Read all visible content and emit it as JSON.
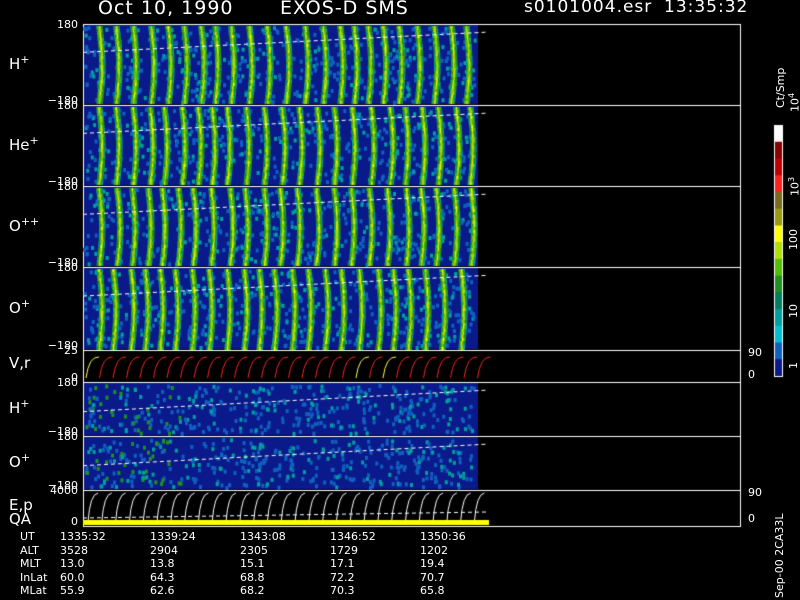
{
  "header": {
    "date": "Oct 10, 1990",
    "instrument": "EXOS-D SMS",
    "file": "s0101004.esr",
    "time": "13:35:32"
  },
  "panels": [
    {
      "label": "H",
      "sup": "+",
      "top_tick": "180",
      "bottom_tick": "−180",
      "kind": "spectro",
      "pattern": "dense"
    },
    {
      "label": "He",
      "sup": "+",
      "top_tick": "180",
      "bottom_tick": "−180",
      "kind": "spectro",
      "pattern": "dense"
    },
    {
      "label": "O",
      "sup": "++",
      "top_tick": "180",
      "bottom_tick": "−180",
      "kind": "spectro",
      "pattern": "dense"
    },
    {
      "label": "O",
      "sup": "+",
      "top_tick": "180",
      "bottom_tick": "−180",
      "kind": "spectro",
      "pattern": "dense"
    },
    {
      "label": "V,r",
      "sup": "",
      "top_tick": "25",
      "bottom_tick": "0",
      "right_top": "90",
      "right_bottom": "0",
      "kind": "line"
    },
    {
      "label": "H",
      "sup": "+",
      "top_tick": "180",
      "bottom_tick": "−180",
      "kind": "spectro",
      "pattern": "sparse"
    },
    {
      "label": "O",
      "sup": "+",
      "top_tick": "180",
      "bottom_tick": "−180",
      "kind": "spectro",
      "pattern": "sparse"
    },
    {
      "label": "E,p",
      "sup": "",
      "top_tick": "4000",
      "bottom_tick": "0",
      "right_top": "90",
      "right_bottom": "0",
      "kind": "line2"
    }
  ],
  "qa_label": "QA",
  "colorbar": {
    "unit": "Ct/Smp",
    "ticks": [
      "10^4",
      "10^3",
      "100",
      "10",
      "1"
    ],
    "colors": [
      "#ffffff",
      "#8b0000",
      "#c00000",
      "#ff2020",
      "#7a6a20",
      "#9a9a10",
      "#ffff00",
      "#b0e000",
      "#50c000",
      "#209020",
      "#008060",
      "#00a0a0",
      "#00c0d0",
      "#1060c0",
      "#0a1a8a"
    ]
  },
  "ephemeris": {
    "labels": [
      "UT",
      "ALT",
      "MLT",
      "InLat",
      "MLat"
    ],
    "columns": [
      [
        "1335:32",
        "3528",
        "13.0",
        "60.0",
        "55.9"
      ],
      [
        "1339:24",
        "2904",
        "13.8",
        "64.3",
        "62.6"
      ],
      [
        "1343:08",
        "2305",
        "15.1",
        "68.8",
        "68.2"
      ],
      [
        "1346:52",
        "1729",
        "17.1",
        "72.2",
        "70.3"
      ],
      [
        "1350:36",
        "1202",
        "19.4",
        "70.7",
        "65.8"
      ]
    ]
  },
  "footer_note": "Sep-00 2CA33L"
}
